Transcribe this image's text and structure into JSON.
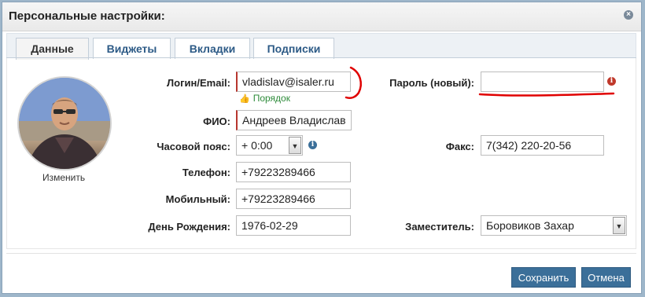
{
  "dialog": {
    "title": "Персональные настройки:",
    "close_icon": "×"
  },
  "tabs": [
    {
      "label": "Данные",
      "active": true
    },
    {
      "label": "Виджеты"
    },
    {
      "label": "Вкладки"
    },
    {
      "label": "Подписки"
    }
  ],
  "avatar": {
    "change_label": "Изменить"
  },
  "form": {
    "login": {
      "label": "Логин/Email:",
      "value": "vladislav@isaler.ru",
      "status": "Порядок"
    },
    "password": {
      "label": "Пароль (новый):",
      "value": ""
    },
    "fio": {
      "label": "ФИО:",
      "value": "Андреев Владислав"
    },
    "timezone": {
      "label": "Часовой пояс:",
      "value": "+ 0:00"
    },
    "fax": {
      "label": "Факс:",
      "value": "7(342) 220-20-56"
    },
    "phone": {
      "label": "Телефон:",
      "value": "+79223289466"
    },
    "mobile": {
      "label": "Мобильный:",
      "value": "+79223289466"
    },
    "birthday": {
      "label": "День Рождения:",
      "value": "1976-02-29"
    },
    "deputy": {
      "label": "Заместитель:",
      "value": "Боровиков Захар"
    }
  },
  "buttons": {
    "save": "Сохранить",
    "cancel": "Отмена"
  },
  "colors": {
    "accent": "#3b6f99",
    "tab_text": "#2c5a86",
    "ok": "#2e8b3a",
    "error": "#c0392b",
    "annotation": "#e00000"
  }
}
